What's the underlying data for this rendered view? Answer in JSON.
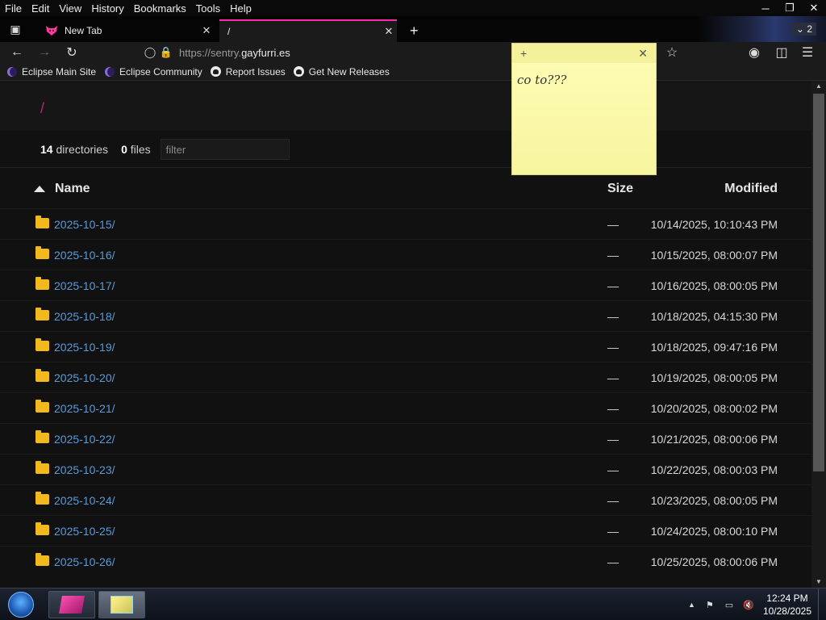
{
  "menubar": {
    "items": [
      "File",
      "Edit",
      "View",
      "History",
      "Bookmarks",
      "Tools",
      "Help"
    ]
  },
  "tabs": [
    {
      "title": "New Tab"
    },
    {
      "title": "/"
    }
  ],
  "tab_count": "2",
  "navbar": {
    "url_prefix": "https://sentry.",
    "url_host": "gayfurri.es"
  },
  "bookmarks": [
    {
      "label": "Eclipse Main Site",
      "icon": "eclipse-icon"
    },
    {
      "label": "Eclipse Community",
      "icon": "eclipse-icon"
    },
    {
      "label": "Report Issues",
      "icon": "github-icon"
    },
    {
      "label": "Get New Releases",
      "icon": "github-icon"
    }
  ],
  "page": {
    "breadcrumb": "/",
    "dir_count": "14",
    "dir_label": "directories",
    "file_count": "0",
    "file_label": "files",
    "filter_placeholder": "filter",
    "columns": {
      "name": "Name",
      "size": "Size",
      "modified": "Modified"
    },
    "rows": [
      {
        "name": "2025-10-15/",
        "size": "—",
        "modified": "10/14/2025, 10:10:43 PM"
      },
      {
        "name": "2025-10-16/",
        "size": "—",
        "modified": "10/15/2025, 08:00:07 PM"
      },
      {
        "name": "2025-10-17/",
        "size": "—",
        "modified": "10/16/2025, 08:00:05 PM"
      },
      {
        "name": "2025-10-18/",
        "size": "—",
        "modified": "10/18/2025, 04:15:30 PM"
      },
      {
        "name": "2025-10-19/",
        "size": "—",
        "modified": "10/18/2025, 09:47:16 PM"
      },
      {
        "name": "2025-10-20/",
        "size": "—",
        "modified": "10/19/2025, 08:00:05 PM"
      },
      {
        "name": "2025-10-21/",
        "size": "—",
        "modified": "10/20/2025, 08:00:02 PM"
      },
      {
        "name": "2025-10-22/",
        "size": "—",
        "modified": "10/21/2025, 08:00:06 PM"
      },
      {
        "name": "2025-10-23/",
        "size": "—",
        "modified": "10/22/2025, 08:00:03 PM"
      },
      {
        "name": "2025-10-24/",
        "size": "—",
        "modified": "10/23/2025, 08:00:05 PM"
      },
      {
        "name": "2025-10-25/",
        "size": "—",
        "modified": "10/24/2025, 08:00:10 PM"
      },
      {
        "name": "2025-10-26/",
        "size": "—",
        "modified": "10/25/2025, 08:00:06 PM"
      }
    ]
  },
  "sticky_note": {
    "text": "co to???"
  },
  "taskbar": {
    "time": "12:24 PM",
    "date": "10/28/2025"
  },
  "colors": {
    "accent": "#ff2aa8",
    "link": "#5a9ad6",
    "folder": "#f2b91e",
    "breadcrumb": "#c0207a"
  }
}
